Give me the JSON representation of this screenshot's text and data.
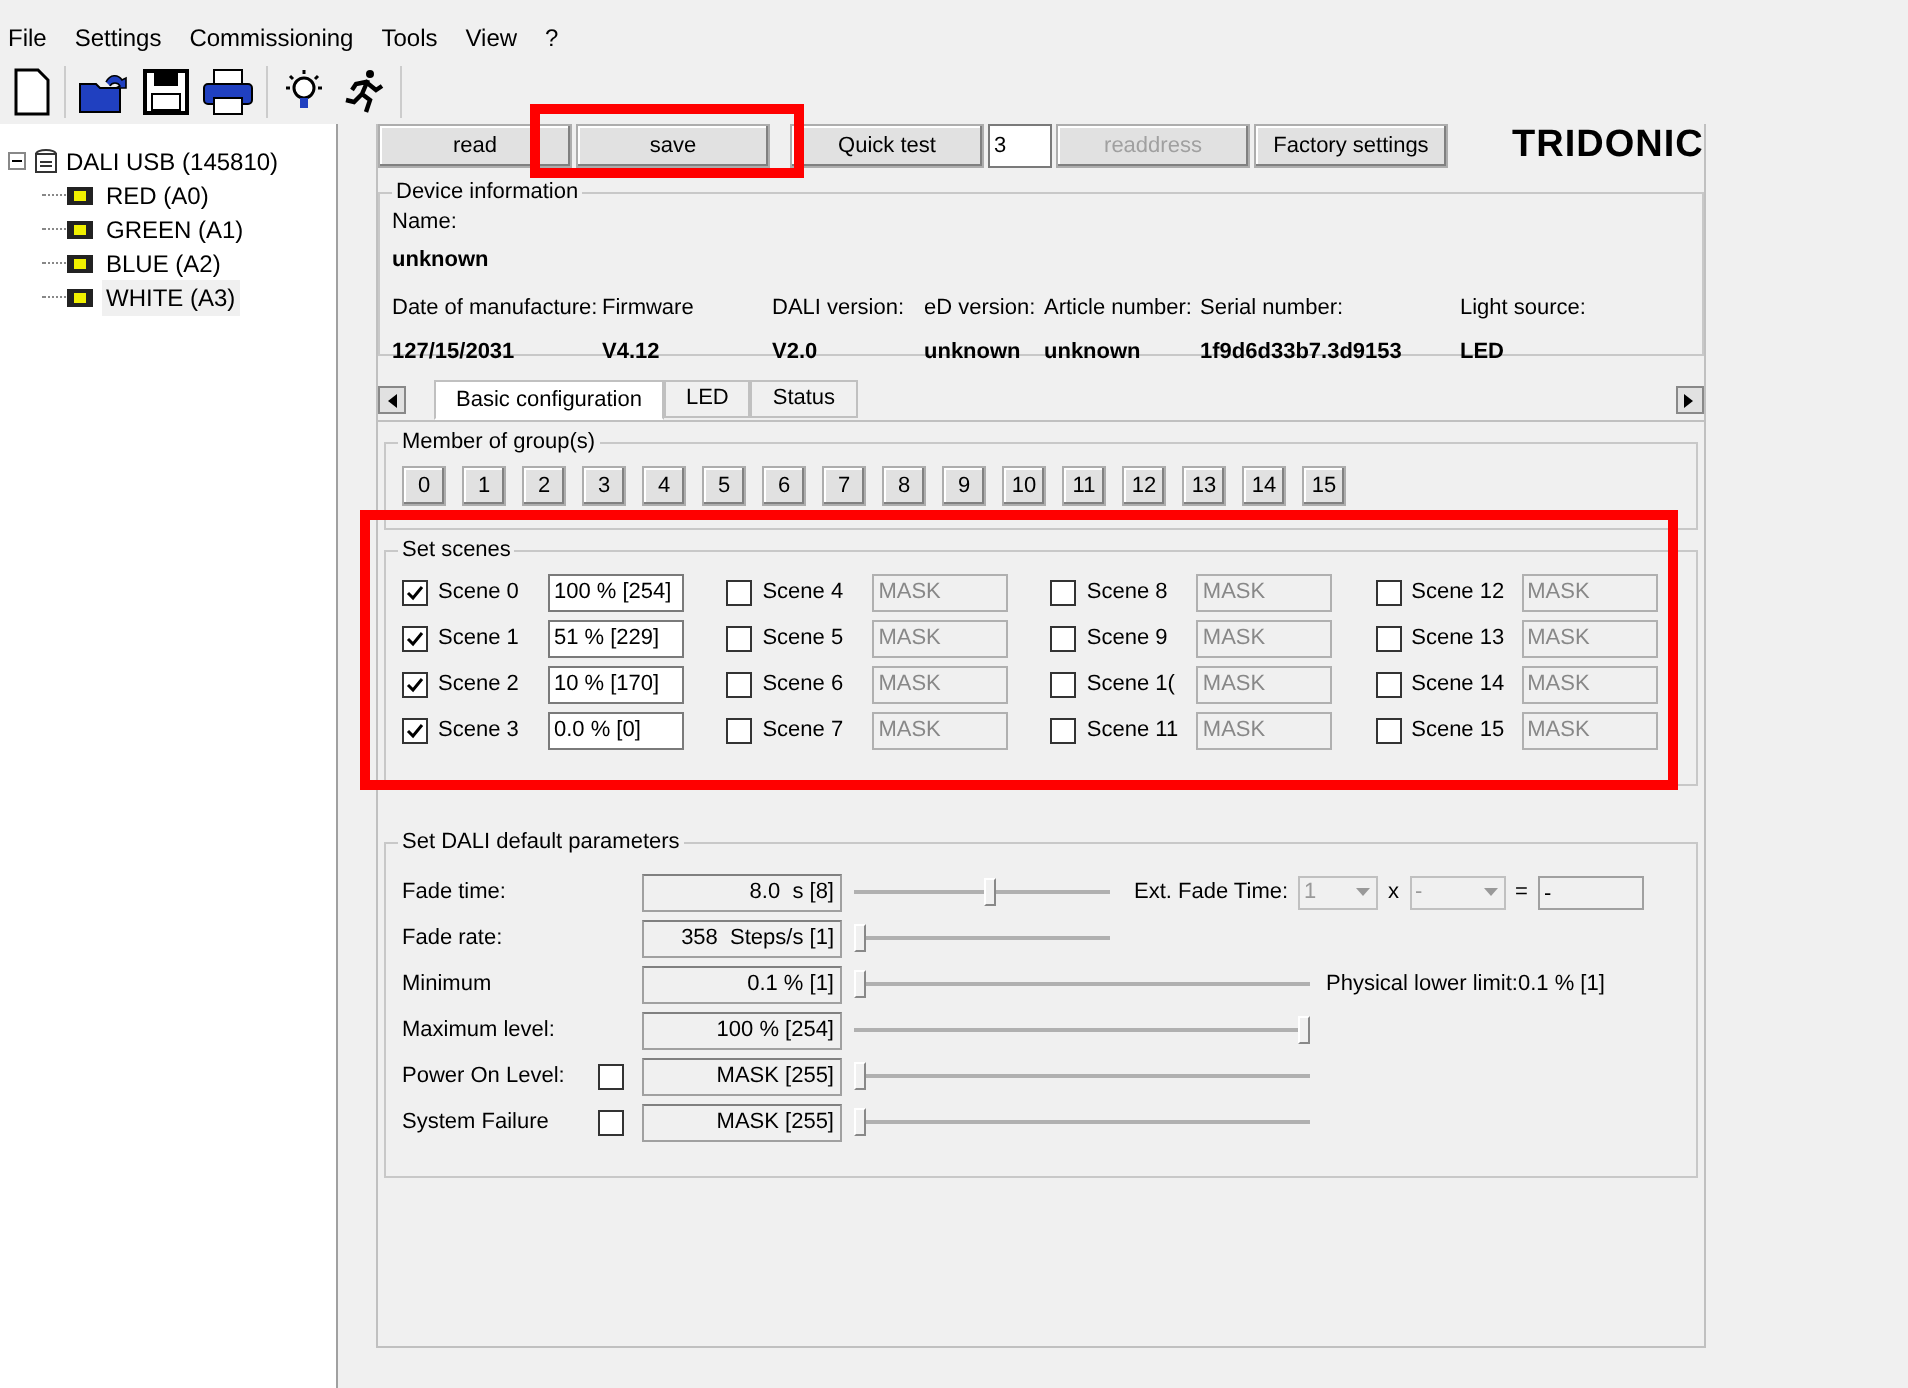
{
  "menu": [
    "File",
    "Settings",
    "Commissioning",
    "Tools",
    "View",
    "?"
  ],
  "tree": {
    "label": "DALI USB (145810)",
    "expanded": true,
    "children": [
      {
        "label": "RED (A0)",
        "selected": false
      },
      {
        "label": "GREEN (A1)",
        "selected": false
      },
      {
        "label": "BLUE (A2)",
        "selected": false
      },
      {
        "label": "WHITE (A3)",
        "selected": true
      }
    ]
  },
  "actions": {
    "read": "read",
    "save": "save",
    "quick_test": "Quick test",
    "address": "3",
    "readdress": "readdress",
    "readdress_disabled": true,
    "factory": "Factory settings"
  },
  "logo": "TRIDONIC",
  "device_info": {
    "title": "Device information",
    "name_label": "Name:",
    "name": "unknown",
    "fields": [
      {
        "label": "Date of manufacture:",
        "value": "127/15/2031"
      },
      {
        "label": "Firmware",
        "value": "V4.12"
      },
      {
        "label": "DALI version:",
        "value": "V2.0"
      },
      {
        "label": "eD version:",
        "value": "unknown"
      },
      {
        "label": "Article number:",
        "value": "unknown"
      },
      {
        "label": "Serial number:",
        "value": "1f9d6d33b7.3d9153"
      },
      {
        "label": "Light source:",
        "value": "LED"
      }
    ]
  },
  "tabs": [
    {
      "label": "Basic configuration",
      "selected": true
    },
    {
      "label": "LED",
      "selected": false
    },
    {
      "label": "Status",
      "selected": false
    }
  ],
  "groups": {
    "title": "Member of group(s)",
    "buttons": [
      "0",
      "1",
      "2",
      "3",
      "4",
      "5",
      "6",
      "7",
      "8",
      "9",
      "10",
      "11",
      "12",
      "13",
      "14",
      "15"
    ]
  },
  "scenes": {
    "title": "Set scenes",
    "items": [
      {
        "label": "Scene 0",
        "checked": true,
        "value": "100 % [254]"
      },
      {
        "label": "Scene 1",
        "checked": true,
        "value": "51 % [229]"
      },
      {
        "label": "Scene 2",
        "checked": true,
        "value": "10 % [170]"
      },
      {
        "label": "Scene 3",
        "checked": true,
        "value": "0.0 % [0]"
      },
      {
        "label": "Scene 4",
        "checked": false,
        "value": "MASK"
      },
      {
        "label": "Scene 5",
        "checked": false,
        "value": "MASK"
      },
      {
        "label": "Scene 6",
        "checked": false,
        "value": "MASK"
      },
      {
        "label": "Scene 7",
        "checked": false,
        "value": "MASK"
      },
      {
        "label": "Scene 8",
        "checked": false,
        "value": "MASK"
      },
      {
        "label": "Scene 9",
        "checked": false,
        "value": "MASK"
      },
      {
        "label": "Scene 1(",
        "checked": false,
        "value": "MASK"
      },
      {
        "label": "Scene 11",
        "checked": false,
        "value": "MASK"
      },
      {
        "label": "Scene 12",
        "checked": false,
        "value": "MASK"
      },
      {
        "label": "Scene 13",
        "checked": false,
        "value": "MASK"
      },
      {
        "label": "Scene 14",
        "checked": false,
        "value": "MASK"
      },
      {
        "label": "Scene 15",
        "checked": false,
        "value": "MASK"
      }
    ]
  },
  "params": {
    "title": "Set DALI default parameters",
    "rows": [
      {
        "label": "Fade time:",
        "value": "8.0  s [8]",
        "kind": "short",
        "level": 0.53
      },
      {
        "label": "Fade rate:",
        "value": "358  Steps/s [1]",
        "kind": "short",
        "level": 0
      },
      {
        "label": "Minimum",
        "value": "0.1 % [1]",
        "kind": "long",
        "level": 0,
        "note": "Physical lower limit:0.1 % [1]"
      },
      {
        "label": "Maximum level:",
        "value": "100 % [254]",
        "kind": "long",
        "level": 1
      },
      {
        "label": "Power On Level:",
        "value": "MASK [255]",
        "kind": "long",
        "level": 0,
        "checked": false
      },
      {
        "label": "System Failure",
        "value": "MASK [255]",
        "kind": "long",
        "level": 0,
        "checked": false
      }
    ],
    "ext": {
      "label": "Ext. Fade Time:",
      "first": "1",
      "times": "x",
      "second": "-",
      "equals": "=",
      "result": "-"
    }
  }
}
